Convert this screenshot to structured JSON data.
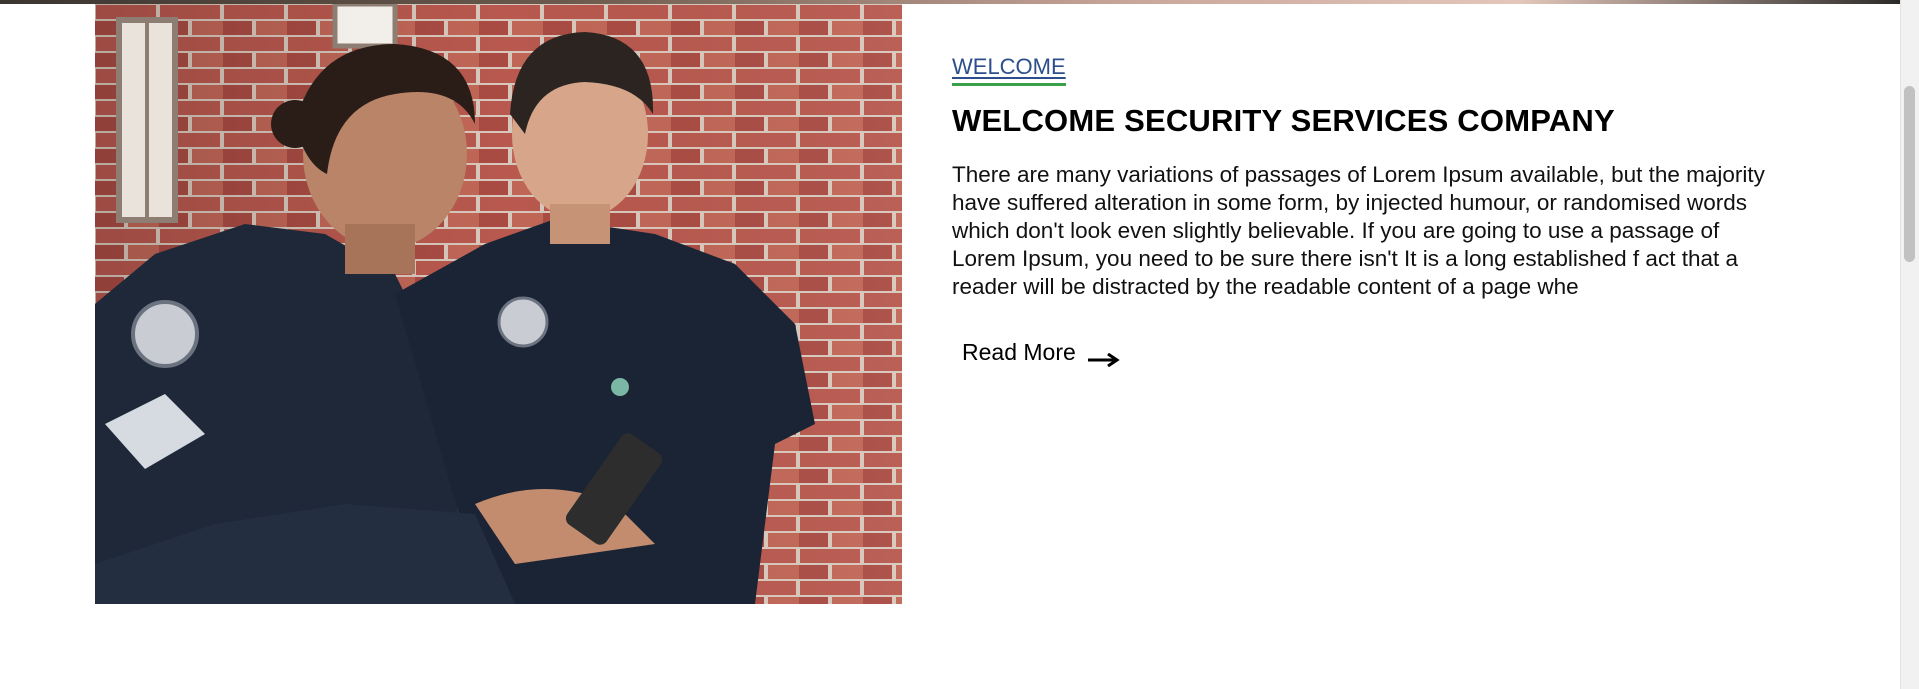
{
  "welcome_section": {
    "eyebrow": "WELCOME",
    "title": "WELCOME SECURITY SERVICES COMPANY",
    "description": "There are many variations of passages of Lorem Ipsum available, but the majority have suffered alteration in some form, by injected humour, or randomised words which don't look even slightly believable. If you are going to use a passage of Lorem Ipsum, you need to be sure there isn't It is a long established f act that a reader will be distracted by the readable content of a page whe",
    "read_more_label": "Read More",
    "read_more_icon": "arrow-right-icon"
  },
  "colors": {
    "eyebrow_text": "#2d4e8c",
    "eyebrow_underline": "#3aa04a",
    "heading": "#000000",
    "body_text": "#111111"
  }
}
